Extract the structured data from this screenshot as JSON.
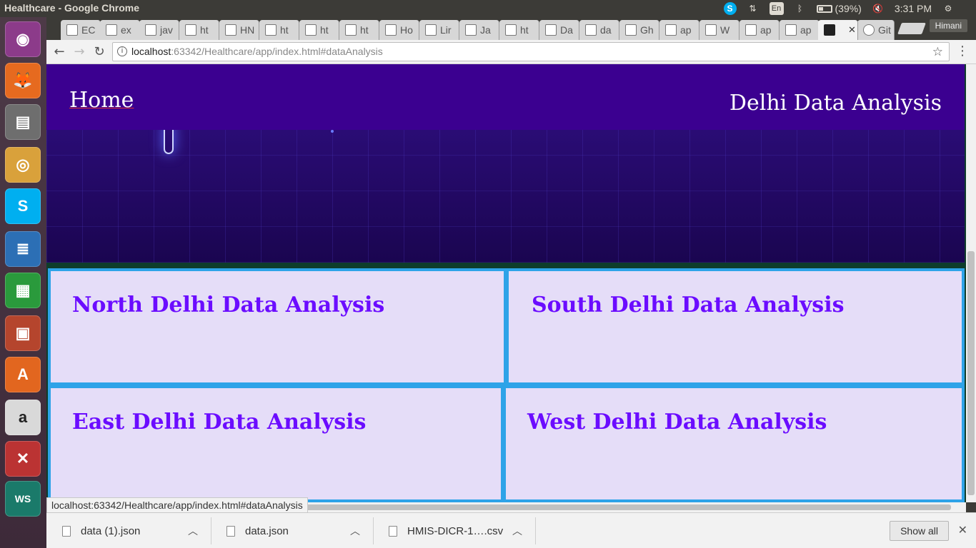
{
  "os_panel": {
    "window_title": "Healthcare - Google Chrome",
    "battery": "(39%)",
    "time": "3:31 PM",
    "lang": "En"
  },
  "browser": {
    "tabs": [
      {
        "label": "EC"
      },
      {
        "label": "ex"
      },
      {
        "label": "jav"
      },
      {
        "label": "ht"
      },
      {
        "label": "HN"
      },
      {
        "label": "ht"
      },
      {
        "label": "ht"
      },
      {
        "label": "ht"
      },
      {
        "label": "Ho"
      },
      {
        "label": "Lir"
      },
      {
        "label": "Ja"
      },
      {
        "label": "ht"
      },
      {
        "label": "Da"
      },
      {
        "label": "da"
      },
      {
        "label": "Gh"
      },
      {
        "label": "ap"
      },
      {
        "label": "W"
      },
      {
        "label": "ap"
      },
      {
        "label": "ap"
      },
      {
        "label": ""
      },
      {
        "label": "Git"
      }
    ],
    "profile_name": "Himani",
    "url_host": "localhost",
    "url_rest": ":63342/Healthcare/app/index.html#dataAnalysis",
    "status_url": "localhost:63342/Healthcare/app/index.html#dataAnalysis"
  },
  "page": {
    "nav_home": "Home",
    "header_title": "Delhi Data Analysis",
    "panels": {
      "north": "North Delhi Data Analysis",
      "south": "South Delhi Data Analysis",
      "east": "East Delhi Data Analysis",
      "west": "West Delhi Data Analysis"
    }
  },
  "downloads": {
    "items": [
      {
        "name": "data (1).json"
      },
      {
        "name": "data.json"
      },
      {
        "name": "HMIS-DICR-1….csv"
      }
    ],
    "show_all": "Show all"
  },
  "launcher": {
    "apps": [
      "ubuntu-dash",
      "firefox",
      "files",
      "chrome",
      "skype",
      "writer",
      "calc",
      "impress",
      "software-center",
      "amazon",
      "system-settings",
      "webstorm"
    ]
  }
}
